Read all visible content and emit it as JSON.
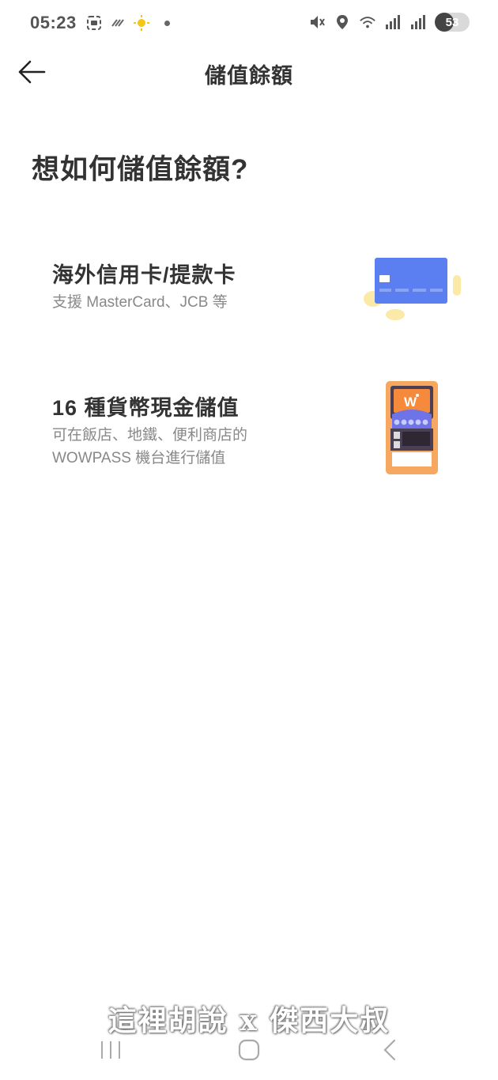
{
  "status_bar": {
    "time": "05:23",
    "battery": "53"
  },
  "app_bar": {
    "title": "儲值餘額",
    "back_icon": "arrow-left-icon"
  },
  "main": {
    "question": "想如何儲值餘額?",
    "options": [
      {
        "title": "海外信用卡/提款卡",
        "subtitle": "支援 MasterCard、JCB 等",
        "icon": "credit-card-icon"
      },
      {
        "title": "16 種貨幣現金儲值",
        "subtitle": "可在飯店、地鐵、便利商店的 WOWPASS 機台進行儲值",
        "icon": "kiosk-machine-icon"
      }
    ]
  },
  "watermark": "這裡胡說 x 傑西大叔",
  "colors": {
    "card_blue": "#5b7ef0",
    "kiosk_orange": "#f6a860",
    "coin_yellow": "#fbe9a7"
  }
}
